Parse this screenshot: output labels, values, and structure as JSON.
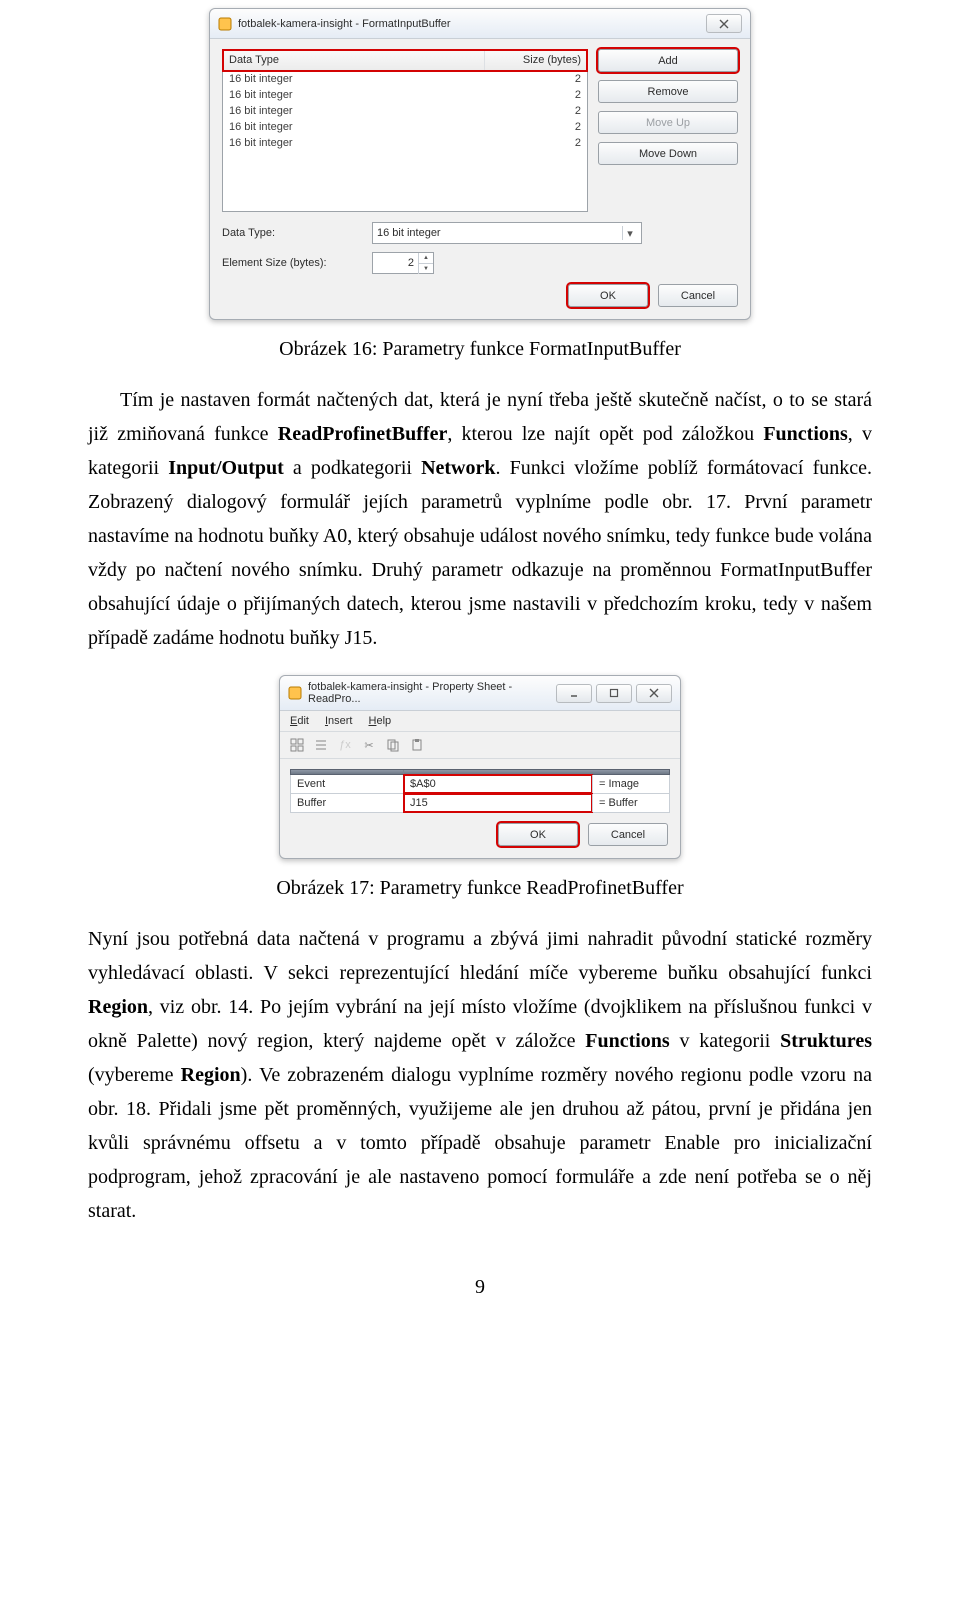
{
  "dialog1": {
    "title": "fotbalek-kamera-insight - FormatInputBuffer",
    "headers": {
      "datatype": "Data Type",
      "size": "Size (bytes)"
    },
    "rows": [
      {
        "type": "16 bit integer",
        "size": "2"
      },
      {
        "type": "16 bit integer",
        "size": "2"
      },
      {
        "type": "16 bit integer",
        "size": "2"
      },
      {
        "type": "16 bit integer",
        "size": "2"
      },
      {
        "type": "16 bit integer",
        "size": "2"
      }
    ],
    "buttons": {
      "add": "Add",
      "remove": "Remove",
      "moveup": "Move Up",
      "movedown": "Move Down"
    },
    "labels": {
      "datatype": "Data Type:",
      "elemsize": "Element Size (bytes):"
    },
    "combo_value": "16 bit integer",
    "spinner_value": "2",
    "footer": {
      "ok": "OK",
      "cancel": "Cancel"
    }
  },
  "caption1": "Obrázek 16: Parametry funkce FormatInputBuffer",
  "para1": "Tím je nastaven formát načtených dat, která je nyní třeba ještě skutečně načíst, o to se stará již zmiňovaná funkce ",
  "para1_b1": "ReadProfinetBuffer",
  "para1_cont1": ", kterou lze najít opět pod záložkou ",
  "para1_b2": "Functions",
  "para1_cont2": ", v kategorii ",
  "para1_b3": "Input/Output",
  "para1_cont3": " a podkategorii ",
  "para1_b4": "Network",
  "para1_cont4": ". Funkci vložíme poblíž formátovací funkce. Zobrazený dialogový formulář jejích parametrů vyplníme podle obr. 17. První parametr nastavíme na hodnotu buňky A0, který obsahuje událost nového snímku, tedy funkce bude volána vždy po načtení nového snímku. Druhý parametr odkazuje na proměnnou FormatInputBuffer obsahující údaje o přijímaných datech, kterou jsme nastavili v předchozím kroku, tedy v našem případě zadáme hodnotu buňky J15.",
  "dialog2": {
    "title": "fotbalek-kamera-insight - Property Sheet - ReadPro...",
    "menu": {
      "edit": "Edit",
      "insert": "Insert",
      "help": "Help"
    },
    "rows": [
      {
        "name": "Event",
        "value": "$A$0",
        "note": "= Image"
      },
      {
        "name": "Buffer",
        "value": "J15",
        "note": "= Buffer"
      }
    ],
    "footer": {
      "ok": "OK",
      "cancel": "Cancel"
    }
  },
  "caption2": "Obrázek 17: Parametry funkce ReadProfinetBuffer",
  "para2_a": "Nyní jsou potřebná data načtená v programu a zbývá jimi nahradit původní statické rozměry vyhledávací oblasti. V sekci reprezentující hledání míče vybereme buňku obsahující funkci ",
  "para2_b1": "Region",
  "para2_b": ", viz obr. 14. Po jejím vybrání na její místo vložíme (dvojklikem na příslušnou funkci v okně Palette) nový region, který najdeme opět v záložce ",
  "para2_b2": "Functions",
  "para2_c": " v kategorii ",
  "para2_b3": "Struktures",
  "para2_d": " (vybereme ",
  "para2_b4": "Region",
  "para2_e": "). Ve zobrazeném dialogu vyplníme rozměry nového regionu podle vzoru na obr. 18. Přidali jsme pět proměnných, využijeme ale jen druhou až pátou, první je přidána jen kvůli správnému offsetu a v tomto případě obsahuje parametr Enable pro inicializační podprogram, jehož zpracování je ale nastaveno pomocí formuláře a zde není potřeba se o něj starat.",
  "page_number": "9"
}
